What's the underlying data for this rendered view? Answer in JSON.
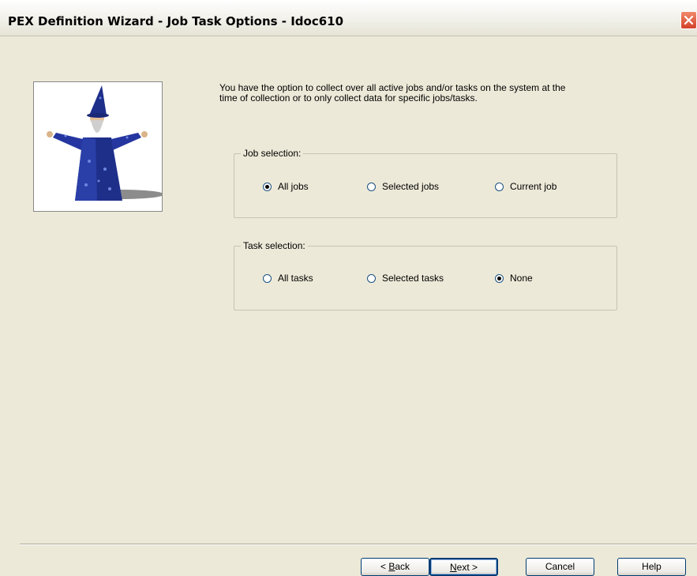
{
  "window": {
    "title": "PEX Definition Wizard - Job Task Options - Idoc610"
  },
  "intro_text": "You have the option to collect over all active jobs and/or tasks on the system at the time of collection or to only collect data for specific jobs/tasks.",
  "job_selection": {
    "legend": "Job selection:",
    "options": [
      {
        "label": "All jobs",
        "selected": true
      },
      {
        "label": "Selected jobs",
        "selected": false
      },
      {
        "label": "Current job",
        "selected": false
      }
    ]
  },
  "task_selection": {
    "legend": "Task selection:",
    "options": [
      {
        "label": "All tasks",
        "selected": false
      },
      {
        "label": "Selected tasks",
        "selected": false
      },
      {
        "label": "None",
        "selected": true
      }
    ]
  },
  "buttons": {
    "back_prefix": "< ",
    "back_mnemonic": "B",
    "back_rest": "ack",
    "next_mnemonic": "N",
    "next_rest": "ext >",
    "cancel": "Cancel",
    "help": "Help"
  }
}
